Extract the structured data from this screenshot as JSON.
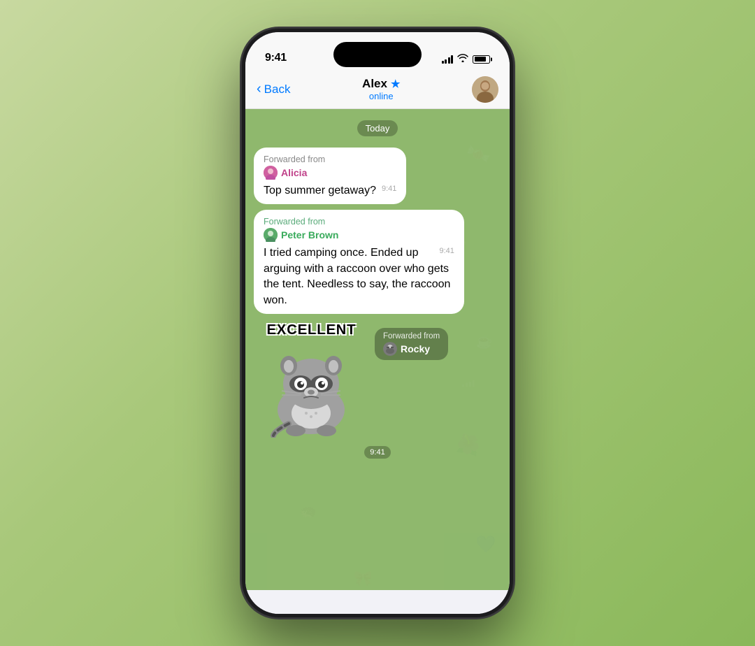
{
  "status_bar": {
    "time": "9:41",
    "signal_label": "signal",
    "wifi_label": "wifi",
    "battery_label": "battery"
  },
  "nav": {
    "back_label": "Back",
    "title": "Alex",
    "star_symbol": "★",
    "subtitle": "online",
    "avatar_initials": "A"
  },
  "chat": {
    "date_separator": "Today",
    "messages": [
      {
        "id": "msg1",
        "forwarded_from_label": "Forwarded from",
        "sender_name": "Alicia",
        "sender_color": "alicia",
        "text": "Top summer getaway?",
        "time": "9:41"
      },
      {
        "id": "msg2",
        "forwarded_from_label": "Forwarded from",
        "sender_name": "Peter Brown",
        "sender_color": "peter",
        "text": "I tried camping once. Ended up arguing with a raccoon over who gets the tent. Needless to say, the raccoon won.",
        "time": "9:41"
      }
    ],
    "sticker_message": {
      "forwarded_from_label": "Forwarded from",
      "sender_name": "Rocky",
      "sticker_text": "EXCELLENT",
      "time": "9:41"
    }
  }
}
